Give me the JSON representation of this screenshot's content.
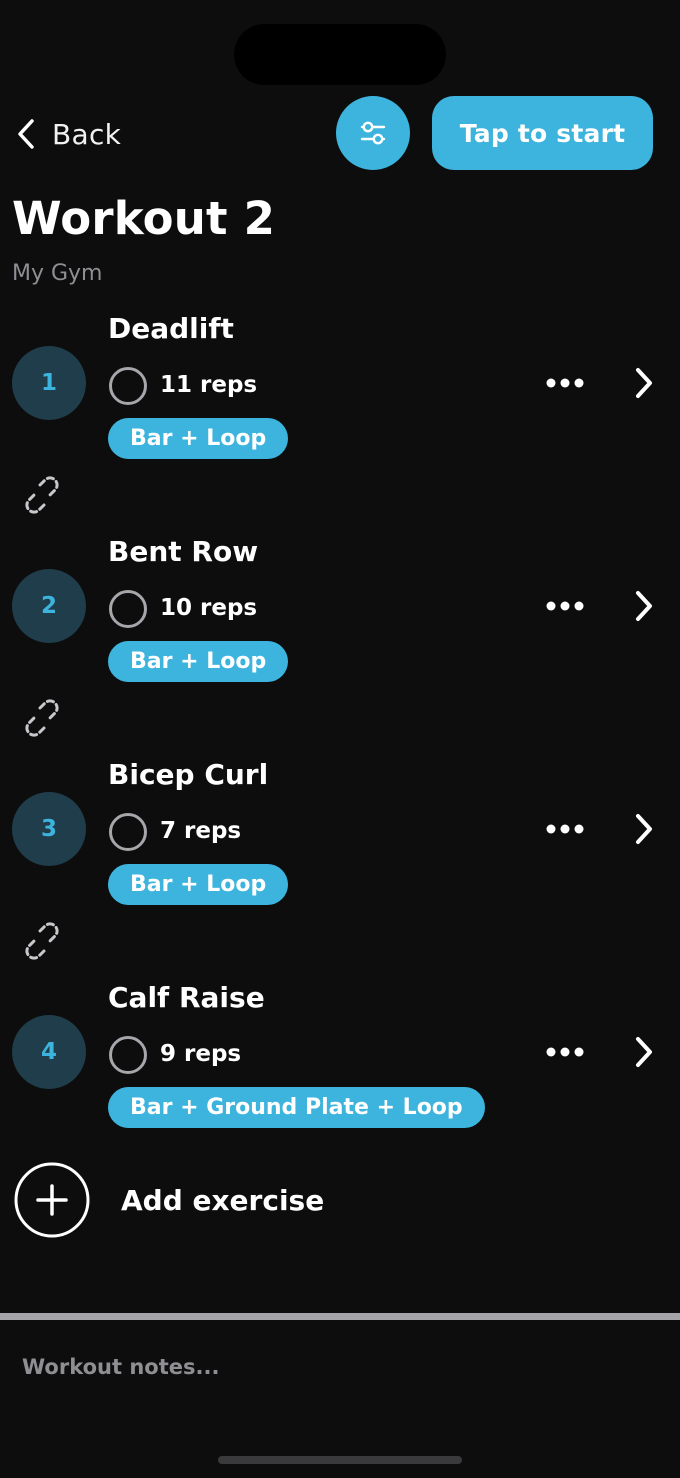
{
  "header": {
    "back_label": "Back",
    "start_label": "Tap to start",
    "accent_color": "#3db4dd"
  },
  "workout": {
    "title": "Workout 2",
    "location": "My Gym"
  },
  "exercises": [
    {
      "number": "1",
      "name": "Deadlift",
      "reps": "11 reps",
      "equipment": "Bar + Loop"
    },
    {
      "number": "2",
      "name": "Bent Row",
      "reps": "10 reps",
      "equipment": "Bar + Loop"
    },
    {
      "number": "3",
      "name": "Bicep Curl",
      "reps": "7 reps",
      "equipment": "Bar + Loop"
    },
    {
      "number": "4",
      "name": "Calf Raise",
      "reps": "9 reps",
      "equipment": "Bar + Ground Plate + Loop"
    }
  ],
  "add_exercise_label": "Add exercise",
  "notes": {
    "placeholder": "Workout notes...",
    "value": ""
  },
  "icons": {
    "back": "chevron-left-icon",
    "filter": "sliders-icon",
    "more": "ellipsis-icon",
    "open": "chevron-right-icon",
    "link": "broken-link-icon",
    "add": "plus-circle-icon"
  }
}
